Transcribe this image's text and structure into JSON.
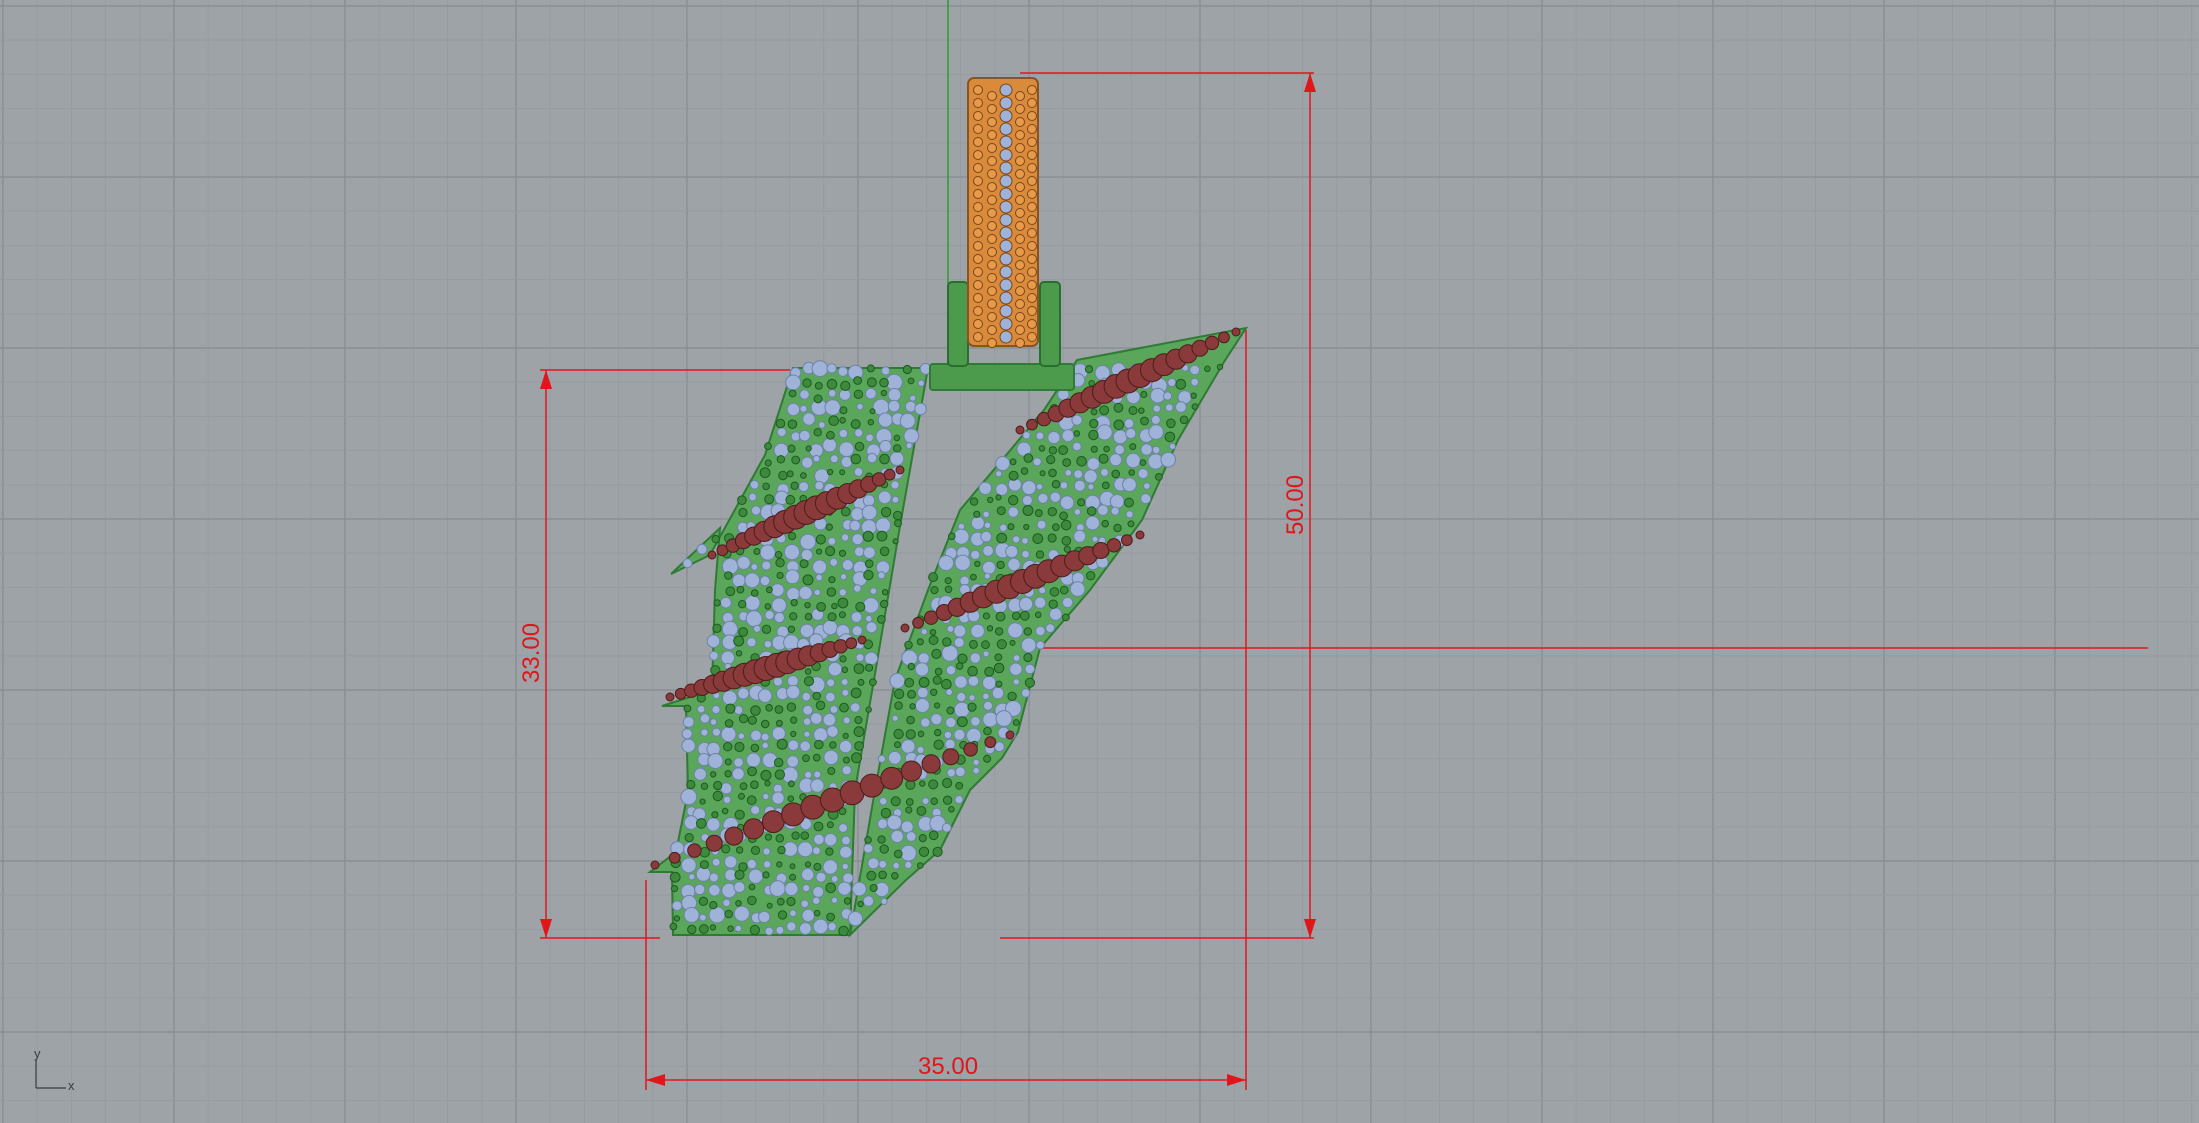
{
  "viewport": {
    "background": "#9ea3a8",
    "grid_minor_color": "#959a9f",
    "grid_major_color": "#878c91",
    "dimension_color": "#e0161b"
  },
  "dimensions": {
    "width": "35.00",
    "height_total": "50.00",
    "height_body": "33.00"
  },
  "axes": {
    "x": "x",
    "y": "y"
  },
  "model": {
    "body_color": "#5aa65a",
    "body_edge_color": "#2f7a34",
    "stone_blue": "#9fb3d8",
    "stone_green": "#3c8a3c",
    "stone_ruby": "#8a3a3a",
    "bail_color": "#d98a3a"
  }
}
